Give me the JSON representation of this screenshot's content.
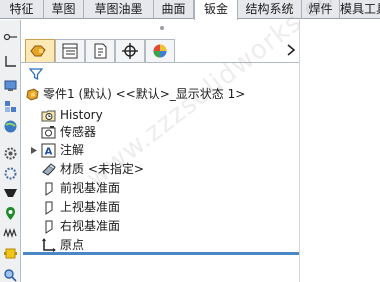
{
  "command_tabs": [
    "特征",
    "草图",
    "草图油墨",
    "曲面",
    "钣金",
    "结构系统",
    "焊件",
    "模具工具"
  ],
  "active_tab": "钣金",
  "feature_tree": {
    "root": "零件1 (默认) <<默认>_显示状态 1>",
    "items": [
      {
        "label": "History",
        "icon": "history-folder-icon",
        "expandable": false
      },
      {
        "label": "传感器",
        "icon": "sensor-icon",
        "expandable": false
      },
      {
        "label": "注解",
        "icon": "annotation-icon",
        "expandable": true
      },
      {
        "label": "材质 <未指定>",
        "icon": "material-icon",
        "expandable": false
      },
      {
        "label": "前视基准面",
        "icon": "plane-icon",
        "expandable": false
      },
      {
        "label": "上视基准面",
        "icon": "plane-icon",
        "expandable": false
      },
      {
        "label": "右视基准面",
        "icon": "plane-icon",
        "expandable": false
      },
      {
        "label": "原点",
        "icon": "origin-icon",
        "expandable": false
      }
    ]
  },
  "panel_tabs": [
    "featuremanager-tab",
    "propertymanager-tab",
    "configurationmanager-tab",
    "dimxpertmanager-tab",
    "displaymanager-tab"
  ],
  "watermark": "www.zzzsolidworks.com",
  "colors": {
    "active_tab_bg": "#ffffff",
    "rollback_bar": "#4a87c4",
    "selected_panel_tab": "#fde9b6"
  }
}
